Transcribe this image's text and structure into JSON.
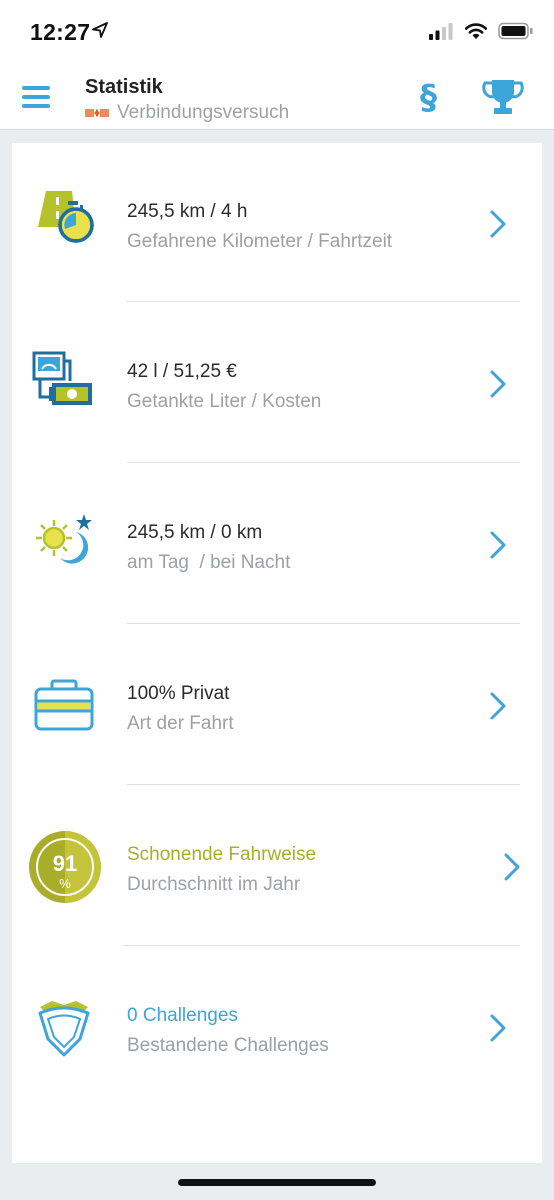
{
  "status": {
    "time": "12:27"
  },
  "nav": {
    "title": "Statistik",
    "subtitle": "Verbindungsversuch",
    "paragraph_label": "§"
  },
  "rows": [
    {
      "title": "245,5 km / 4 h",
      "subtitle": "Gefahrene Kilometer / Fahrtzeit",
      "icon": "road-stopwatch-icon"
    },
    {
      "title": "42 l / 51,25 €",
      "subtitle": "Getankte Liter / Kosten",
      "icon": "fuel-money-icon"
    },
    {
      "title": "245,5 km / 0 km",
      "subtitle": "am Tag  / bei Nacht",
      "icon": "sun-moon-icon"
    },
    {
      "title": "100% Privat",
      "subtitle": "Art der Fahrt",
      "icon": "briefcase-icon"
    },
    {
      "title": "Schonende Fahrweise",
      "subtitle": "Durchschnitt im Jahr",
      "icon": "score-badge-icon",
      "score": "91",
      "score_unit": "%"
    },
    {
      "title": "0 Challenges",
      "subtitle": "Bestandene Challenges",
      "icon": "shield-icon"
    }
  ],
  "colors": {
    "accent_blue": "#3ea5da",
    "accent_green": "#a9ad2a",
    "icon_green": "#b5c22a",
    "icon_yellow": "#e8e14a"
  }
}
